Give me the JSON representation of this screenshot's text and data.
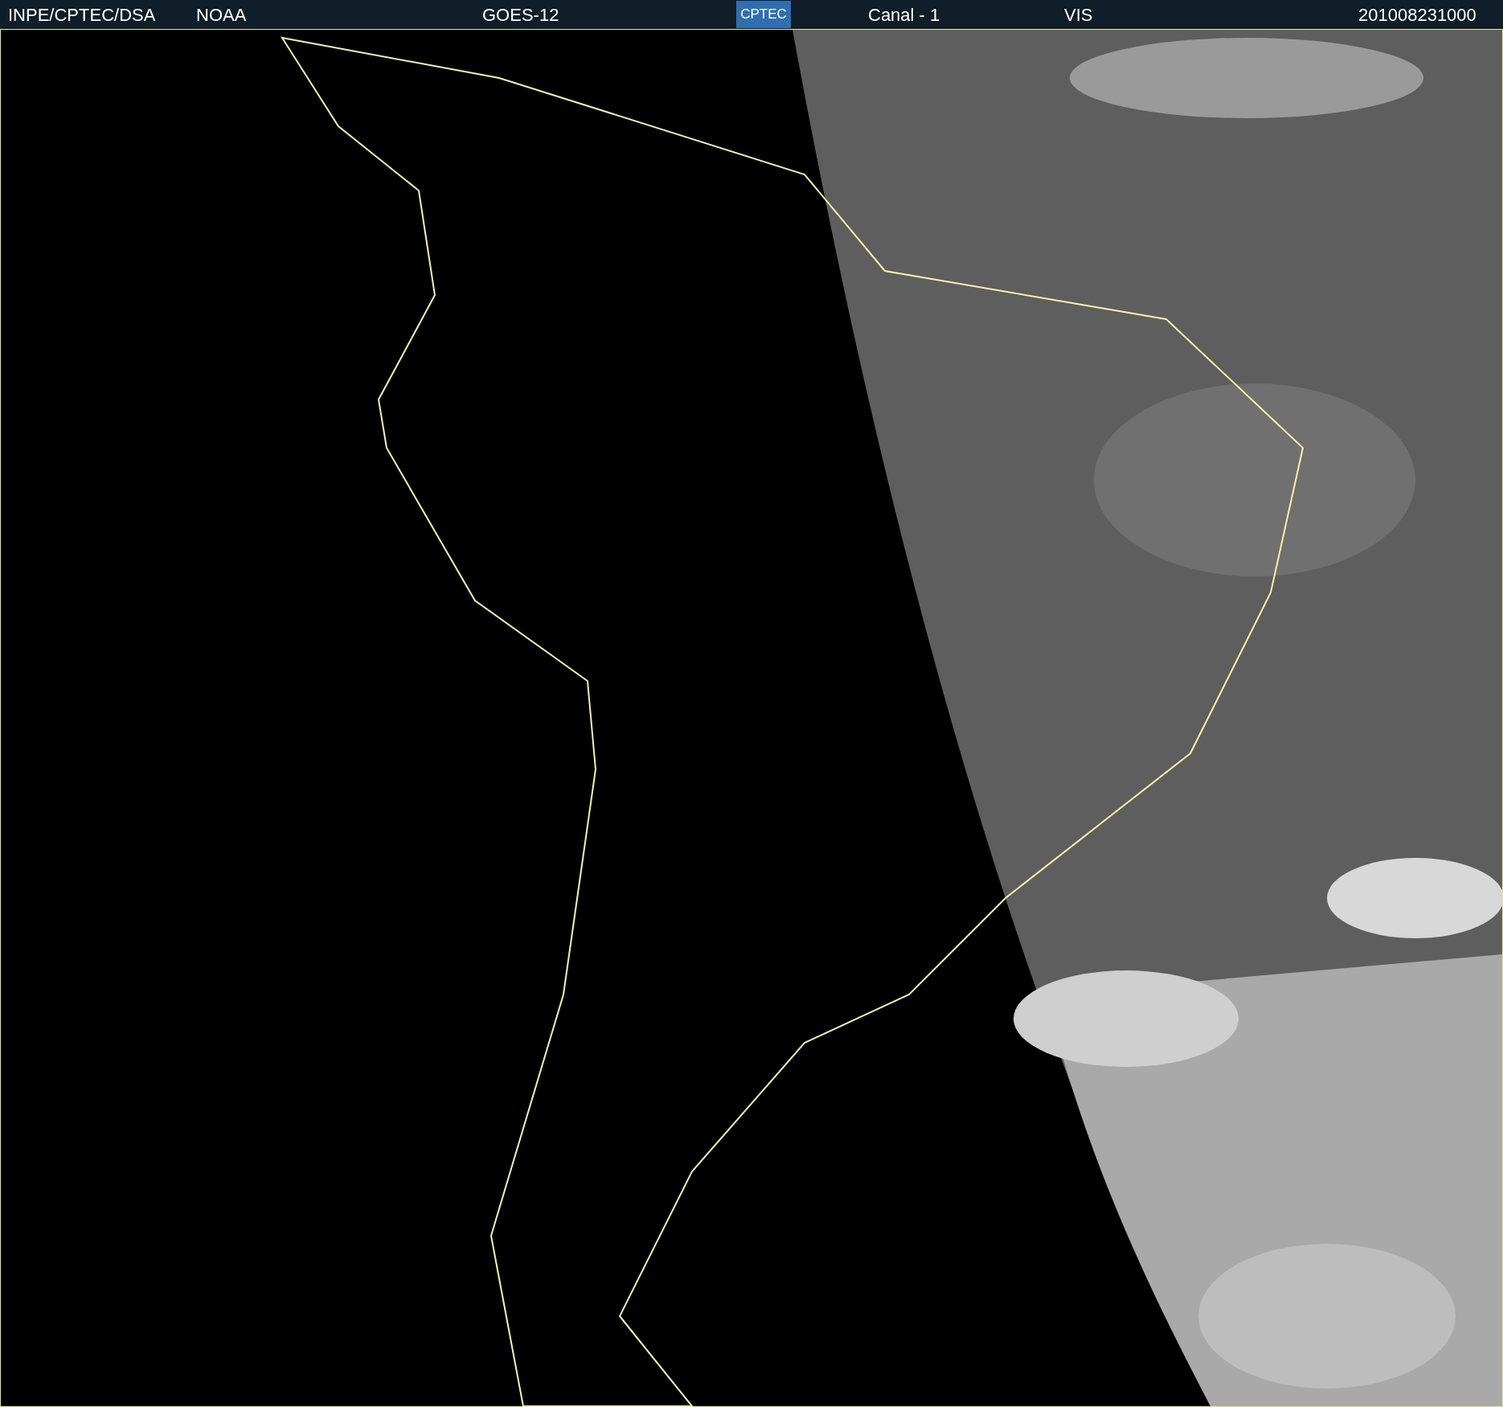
{
  "header": {
    "agency": "INPE/CPTEC/DSA",
    "source": "NOAA",
    "satellite": "GOES-12",
    "logo": "CPTEC",
    "channel": "Canal - 1",
    "band": "VIS",
    "timestamp": "201008231000"
  }
}
